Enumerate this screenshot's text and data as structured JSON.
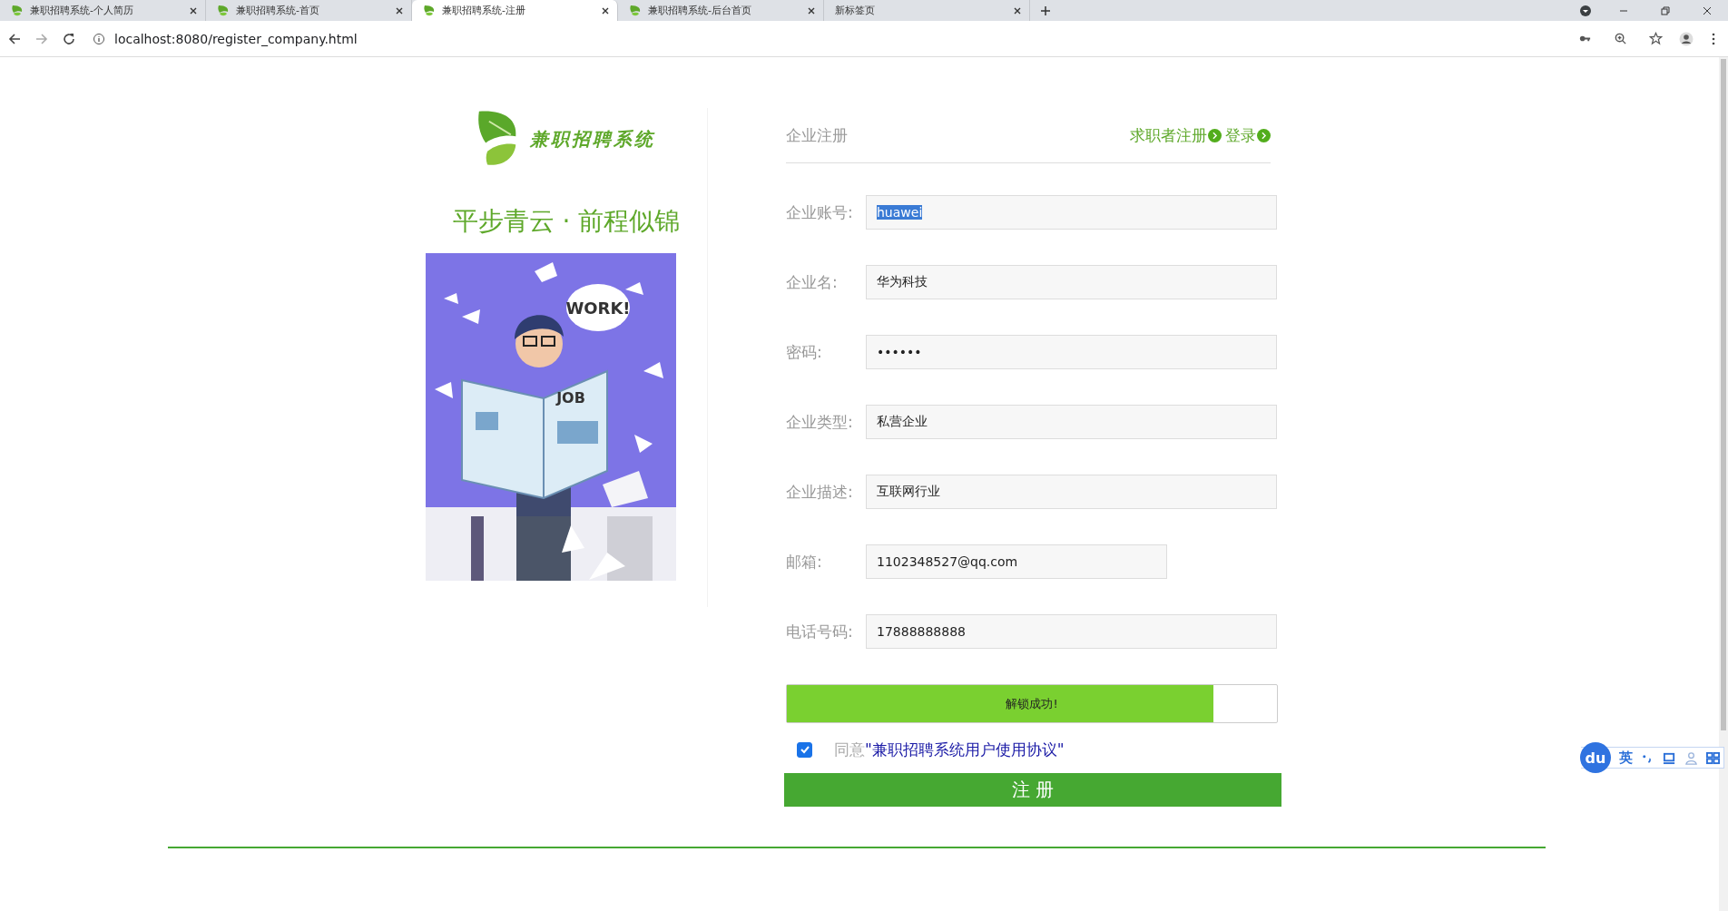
{
  "browser": {
    "tabs": [
      {
        "title": "兼职招聘系统-个人简历",
        "selected": false,
        "kind": "site"
      },
      {
        "title": "兼职招聘系统-首页",
        "selected": false,
        "kind": "site"
      },
      {
        "title": "兼职招聘系统-注册",
        "selected": true,
        "kind": "site"
      },
      {
        "title": "兼职招聘系统-后台首页",
        "selected": false,
        "kind": "site"
      },
      {
        "title": "新标签页",
        "selected": false,
        "kind": "blank"
      }
    ],
    "url": "localhost:8080/register_company.html"
  },
  "brand": {
    "logo_text": "兼职招聘系统",
    "slogan": "平步青云 · 前程似锦"
  },
  "illustration": {
    "bubble": "WORK!",
    "paper": "JOB"
  },
  "header": {
    "title": "企业注册",
    "links": [
      "求职者注册",
      "登录"
    ]
  },
  "fields": [
    {
      "label": "企业账号:",
      "value": "huawei",
      "kind": "text",
      "highlighted": true
    },
    {
      "label": "企业名:",
      "value": "华为科技",
      "kind": "text",
      "highlighted": false
    },
    {
      "label": "密码:",
      "value": "••••••",
      "kind": "password",
      "highlighted": false
    },
    {
      "label": "企业类型:",
      "value": "私营企业",
      "kind": "text",
      "highlighted": false
    },
    {
      "label": "企业描述:",
      "value": "互联网行业",
      "kind": "text",
      "highlighted": false
    },
    {
      "label": "邮箱:",
      "value": "1102348527@qq.com",
      "kind": "email",
      "highlighted": false
    },
    {
      "label": "电话号码:",
      "value": "17888888888",
      "kind": "text",
      "highlighted": false
    }
  ],
  "slider": {
    "text": "解锁成功!",
    "level": 0.87
  },
  "agreement": {
    "checked": true,
    "prefix": "同意",
    "link": "\"兼职招聘系统用户使用协议\""
  },
  "submit": "注 册",
  "ime": {
    "logo": "du",
    "mode": "英"
  }
}
